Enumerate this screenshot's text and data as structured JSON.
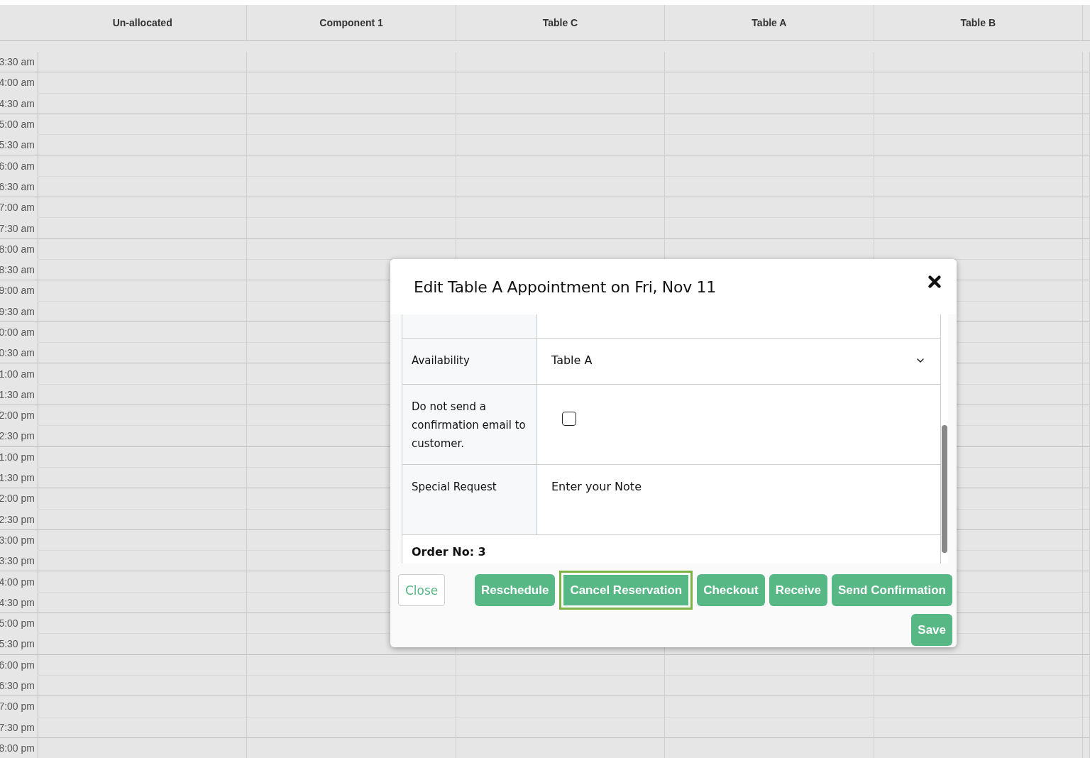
{
  "columns": [
    "Un-allocated",
    "Component 1",
    "Table C",
    "Table A",
    "Table B"
  ],
  "time_slots": [
    "3:30 am",
    "4:00 am",
    "4:30 am",
    "5:00 am",
    "5:30 am",
    "6:00 am",
    "6:30 am",
    "7:00 am",
    "7:30 am",
    "8:00 am",
    "8:30 am",
    "9:00 am",
    "9:30 am",
    "0:00 am",
    "0:30 am",
    "1:00 am",
    "1:30 am",
    "2:00 pm",
    "2:30 pm",
    "1:00 pm",
    "1:30 pm",
    "2:00 pm",
    "2:30 pm",
    "3:00 pm",
    "3:30 pm",
    "4:00 pm",
    "4:30 pm",
    "5:00 pm",
    "5:30 pm",
    "6:00 pm",
    "6:30 pm",
    "7:00 pm",
    "7:30 pm",
    "8:00 pm"
  ],
  "dialog": {
    "title": "Edit Table A Appointment on Fri, Nov 11",
    "fields": [
      {
        "kind": "select",
        "label": "Availability",
        "value": "Table A"
      },
      {
        "kind": "checkbox",
        "label": "Do not send a confirmation email to customer.",
        "checked": false
      },
      {
        "kind": "textarea",
        "label": "Special Request",
        "placeholder": "Enter your Note"
      }
    ],
    "order": "Order No: 3",
    "close_button": "Close",
    "actions": [
      {
        "label": "Reschedule",
        "focused": false
      },
      {
        "label": "Cancel Reservation",
        "focused": true
      },
      {
        "label": "Checkout",
        "focused": false
      },
      {
        "label": "Receive",
        "focused": false
      },
      {
        "label": "Send Confirmation",
        "focused": false
      }
    ],
    "save_button": "Save"
  }
}
